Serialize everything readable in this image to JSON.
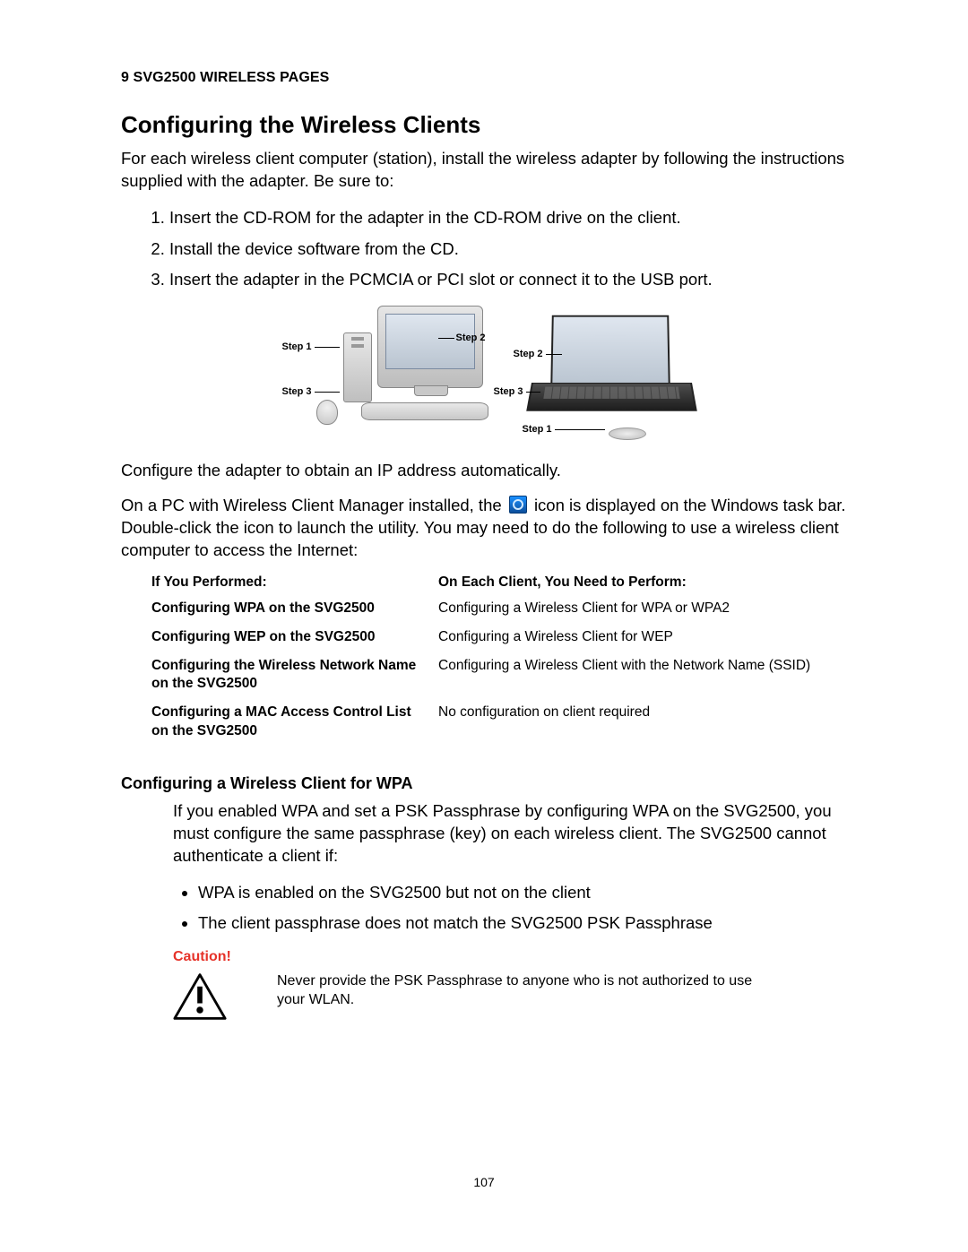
{
  "chapter_head": "9 SVG2500 WIRELESS PAGES",
  "h1": "Configuring the Wireless Clients",
  "intro": "For each wireless client computer (station), install the wireless adapter by following the instructions supplied with the adapter. Be sure to:",
  "steps": [
    "Insert the CD-ROM for the adapter in the CD-ROM drive on the client.",
    "Install the device software from the CD.",
    "Insert the adapter in the PCMCIA or PCI slot or connect it to the USB port."
  ],
  "fig_labels": {
    "d_step1": "Step 1",
    "d_step2": "Step 2",
    "d_step3": "Step 3",
    "l_step1": "Step 1",
    "l_step2": "Step 2",
    "l_step3": "Step 3"
  },
  "after_fig": "Configure the adapter to obtain an IP address automatically.",
  "tray_para_a": "On a PC with Wireless Client Manager installed, the ",
  "tray_para_b": " icon is displayed on the Windows task bar. Double-click the icon to launch the utility. You may need to do the following to use a wireless client computer to access the Internet:",
  "table": {
    "head_left": "If You Performed:",
    "head_right": "On Each Client, You Need to Perform:",
    "rows": [
      {
        "l": "Configuring WPA on the SVG2500",
        "r": "Configuring a Wireless Client for WPA or WPA2"
      },
      {
        "l": "Configuring WEP on the SVG2500",
        "r": "Configuring a Wireless Client for WEP"
      },
      {
        "l": "Configuring the Wireless Network Name on the SVG2500",
        "r": "Configuring a Wireless Client with the Network Name (SSID)"
      },
      {
        "l": "Configuring a MAC Access Control List on the SVG2500",
        "r": "No configuration on client required"
      }
    ]
  },
  "h2": "Configuring a Wireless Client for WPA",
  "wpa_para": "If you enabled WPA and set a PSK Passphrase by configuring WPA on the SVG2500, you must configure the same passphrase (key) on each wireless client. The SVG2500 cannot authenticate a client if:",
  "bullets": [
    "WPA is enabled on the SVG2500 but not on the client",
    "The client passphrase does not match the SVG2500 PSK Passphrase"
  ],
  "caution_label": "Caution!",
  "caution_text": "Never provide the PSK Passphrase to anyone who is not authorized to use your WLAN.",
  "page_number": "107"
}
